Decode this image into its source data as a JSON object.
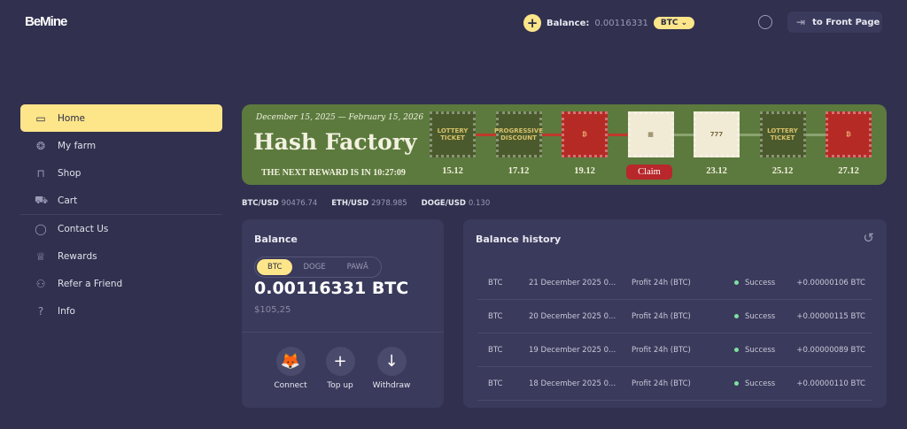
{
  "header": {
    "logo": "BeMine",
    "balance_label": "Balance:",
    "balance_value": "0.00116331",
    "currency": "BTC",
    "front_page": "to Front Page"
  },
  "sidebar": {
    "items": [
      {
        "label": "Home",
        "icon": "wallet-icon",
        "glyph": "▭"
      },
      {
        "label": "My farm",
        "icon": "farm-icon",
        "glyph": "❂"
      },
      {
        "label": "Shop",
        "icon": "bag-icon",
        "glyph": "⊓"
      },
      {
        "label": "Cart",
        "icon": "cart-icon",
        "glyph": "⛟"
      },
      {
        "label": "Contact Us",
        "icon": "chat-icon",
        "glyph": "◯"
      },
      {
        "label": "Rewards",
        "icon": "trophy-icon",
        "glyph": "♕"
      },
      {
        "label": "Refer a Friend",
        "icon": "add-user-icon",
        "glyph": "⚇"
      },
      {
        "label": "Info",
        "icon": "help-icon",
        "glyph": "?"
      }
    ]
  },
  "banner": {
    "dates": "December 15, 2025 — February 15, 2026",
    "title": "Hash Factory",
    "next_reward": "THE NEXT REWARD IS IN 10:27:09",
    "stamps": [
      {
        "label": "15.12",
        "art": "LOTTERY TICKET"
      },
      {
        "label": "17.12",
        "art": "PROGRESSIVE DISCOUNT"
      },
      {
        "label": "19.12",
        "art": "₿"
      },
      {
        "label": "Claim",
        "art": "▦"
      },
      {
        "label": "23.12",
        "art": "777"
      },
      {
        "label": "25.12",
        "art": "LOTTERY TICKET"
      },
      {
        "label": "27.12",
        "art": "₿"
      }
    ]
  },
  "rates": [
    {
      "pair": "BTC/USD",
      "value": "90476.74"
    },
    {
      "pair": "ETH/USD",
      "value": "2978.985"
    },
    {
      "pair": "DOGE/USD",
      "value": "0.130"
    }
  ],
  "balance": {
    "title": "Balance",
    "tabs": [
      "BTC",
      "DOGE",
      "PAWĀ"
    ],
    "amount": "0.00116331 BTC",
    "usd": "$105,25",
    "actions": [
      "Connect",
      "Top up",
      "Withdraw"
    ]
  },
  "history": {
    "title": "Balance history",
    "rows": [
      {
        "coin": "BTC",
        "date": "21 December 2025 0...",
        "type": "Profit 24h (BTC)",
        "status": "Success",
        "amount": "+0.00000106 BTC"
      },
      {
        "coin": "BTC",
        "date": "20 December 2025 0...",
        "type": "Profit 24h (BTC)",
        "status": "Success",
        "amount": "+0.00000115 BTC"
      },
      {
        "coin": "BTC",
        "date": "19 December 2025 0...",
        "type": "Profit 24h (BTC)",
        "status": "Success",
        "amount": "+0.00000089 BTC"
      },
      {
        "coin": "BTC",
        "date": "18 December 2025 0...",
        "type": "Profit 24h (BTC)",
        "status": "Success",
        "amount": "+0.00000110 BTC"
      }
    ]
  }
}
